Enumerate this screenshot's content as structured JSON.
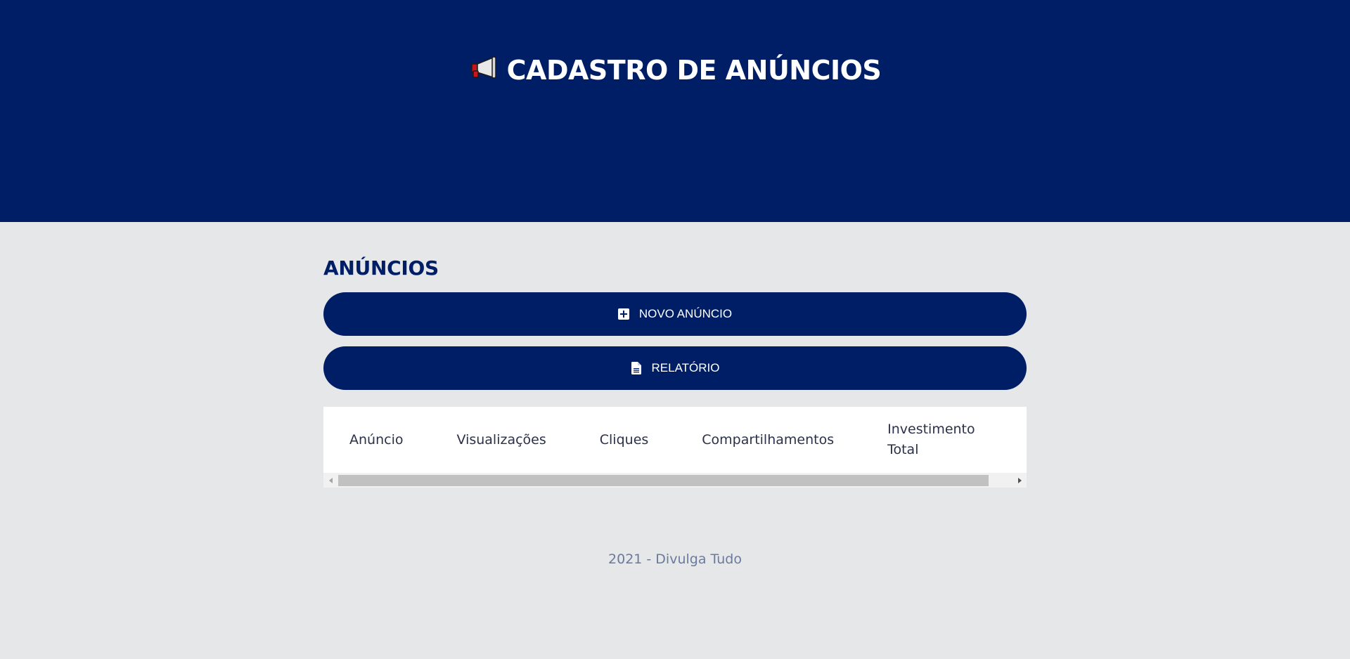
{
  "header": {
    "title": "CADASTRO DE ANÚNCIOS",
    "icon": "megaphone-icon"
  },
  "main": {
    "section_title": "ANÚNCIOS",
    "buttons": {
      "new_ad": {
        "label": "NOVO ANÚNCIO",
        "icon": "plus-square-icon"
      },
      "report": {
        "label": "RELATÓRIO",
        "icon": "document-icon"
      }
    },
    "table": {
      "columns": [
        "Anúncio",
        "Visualizações",
        "Cliques",
        "Compartilhamentos",
        "Investimento Total"
      ]
    }
  },
  "footer": {
    "text": "2021 - Divulga Tudo"
  },
  "colors": {
    "brand": "#001e66",
    "background": "#e6e7e9",
    "footer_text": "#6b7a9c"
  }
}
